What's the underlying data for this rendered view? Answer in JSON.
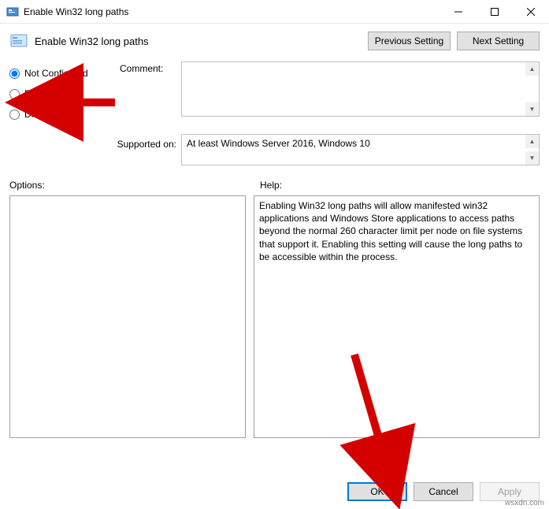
{
  "window": {
    "title": "Enable Win32 long paths"
  },
  "header": {
    "title": "Enable Win32 long paths",
    "prev": "Previous Setting",
    "next": "Next Setting"
  },
  "radios": {
    "not_configured": "Not Configured",
    "enabled": "Enabled",
    "disabled": "Disabled"
  },
  "labels": {
    "comment": "Comment:",
    "supported": "Supported on:",
    "options": "Options:",
    "help": "Help:"
  },
  "supported_text": "At least Windows Server 2016, Windows 10",
  "help_text": "Enabling Win32 long paths will allow manifested win32 applications and Windows Store applications to access paths beyond the normal 260 character limit per node on file systems that support it.  Enabling this setting will cause the long paths to be accessible within the process.",
  "footer": {
    "ok": "OK",
    "cancel": "Cancel",
    "apply": "Apply"
  },
  "watermark": "wsxdn.com"
}
